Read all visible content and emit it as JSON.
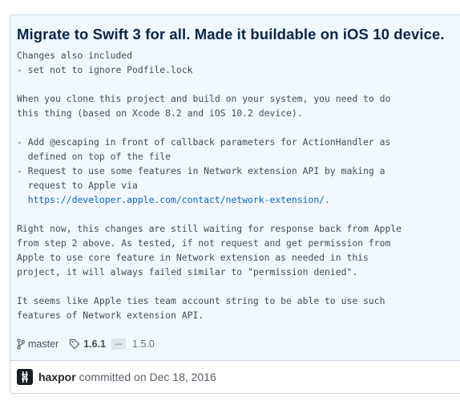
{
  "commit": {
    "title": "Migrate to Swift 3 for all. Made it buildable on iOS 10 device.",
    "description_lines": {
      "l01": "Changes also included",
      "l02": "- set not to ignore Podfile.lock",
      "l04": "When you clone this project and build on your system, you need to do",
      "l05": "this thing (based on Xcode 8.2 and iOS 10.2 device).",
      "l07": "- Add @escaping in front of callback parameters for ActionHandler as",
      "l08": "  defined on top of the file",
      "l09": "- Request to use some features in Network extension API by making a",
      "l10": "  request to Apple via",
      "l11_link": "https://developer.apple.com/contact/network-extension/",
      "l11_suffix": ".",
      "l13": "Right now, this changes are still waiting for response back from Apple",
      "l14": "from step 2 above. As tested, if not request and get permission from",
      "l15": "Apple to use core feature in Network extension as needed in this",
      "l16": "project, it will always failed similar to \"permission denied\".",
      "l18": "It seems like Apple ties team account string to be able to use such",
      "l19": "features of Network extension API."
    },
    "link_url": "https://developer.apple.com/contact/network-extension/"
  },
  "branches": {
    "branch": "master",
    "tag": "1.6.1",
    "ellipsis": "…",
    "old_tag": "1.5.0"
  },
  "meta": {
    "author": "haxpor",
    "committed_text": " committed on Dec 18, 2016"
  },
  "icons": {
    "branch": "git-branch-icon",
    "tag": "tag-icon",
    "avatar": "avatar-glyph"
  },
  "colors": {
    "header_bg": "#f1f8ff",
    "border": "#c9d7e6",
    "title": "#05264c",
    "link": "#0366d6"
  }
}
